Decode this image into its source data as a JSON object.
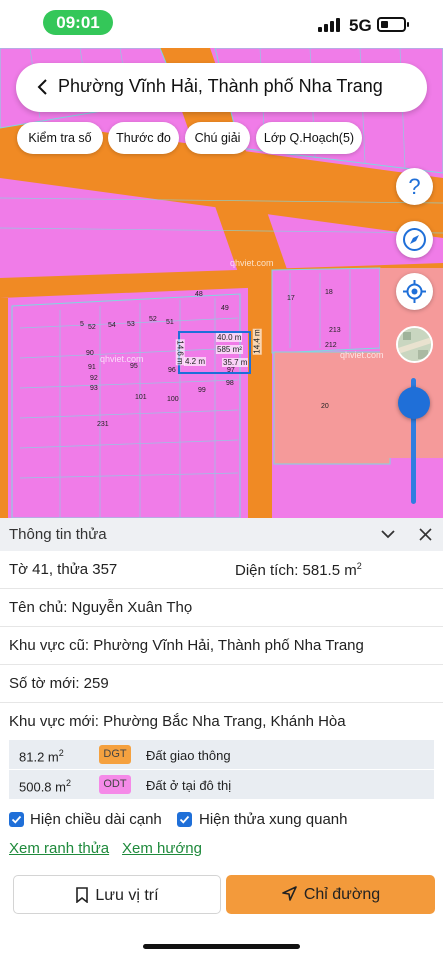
{
  "status": {
    "time": "09:01",
    "network": "5G"
  },
  "header": {
    "title": "Phường Vĩnh Hải, Thành phố Nha Trang"
  },
  "chips": [
    "Kiểm tra số",
    "Thước đo",
    "Chú giải",
    "Lớp Q.Hoạch(5)"
  ],
  "map_controls": {
    "help_symbol": "?"
  },
  "map": {
    "plot_labels": [
      "48",
      "49",
      "17",
      "18",
      "52",
      "51",
      "5",
      "52",
      "54",
      "53",
      "213",
      "212",
      "90",
      "91",
      "92",
      "93",
      "95",
      "96",
      "97",
      "98",
      "99",
      "100",
      "101",
      "231",
      "20"
    ],
    "dimensions": {
      "top": "40.0 m",
      "area": "585 m²",
      "left": "14.6 m",
      "right": "14.4 m",
      "bottom_left": "4.2 m",
      "bottom_right": "35.7 m"
    },
    "watermarks": [
      "qhviet.com",
      "qhviet.com",
      "qhviet.com"
    ]
  },
  "panel": {
    "title": "Thông tin thửa",
    "sheet_parcel": "Tờ 41, thửa 357",
    "area_label": "Diện tích: 581.5 m",
    "area_sup": "2",
    "owner": "Tên chủ: Nguyễn Xuân Thọ",
    "old_area": "Khu vực cũ: Phường Vĩnh Hải, Thành phố Nha Trang",
    "new_sheet": "Số tờ mới: 259",
    "new_area": "Khu vực mới: Phường Bắc Nha Trang, Khánh Hòa",
    "land_uses": [
      {
        "area": "81.2 m",
        "sup": "2",
        "code": "DGT",
        "desc": "Đất giao thông",
        "color": "#f5a13f"
      },
      {
        "area": "500.8 m",
        "sup": "2",
        "code": "ODT",
        "desc": "Đất ở tại đô thị",
        "color": "#f58ae8"
      }
    ],
    "checkbox_edge_length": "Hiện chiều dài cạnh",
    "checkbox_neighbors": "Hiện thửa xung quanh",
    "link_boundary": "Xem ranh thửa",
    "link_direction": "Xem hướng",
    "save_button": "Lưu vị trí",
    "directions_button": "Chỉ đường"
  },
  "colors": {
    "accent": "#1f6fd8",
    "road": "#f08a24",
    "residential": "#f07ce8",
    "commercial": "#f59a9a",
    "primary_button": "#f39a3b",
    "link": "#1f8a3c"
  }
}
